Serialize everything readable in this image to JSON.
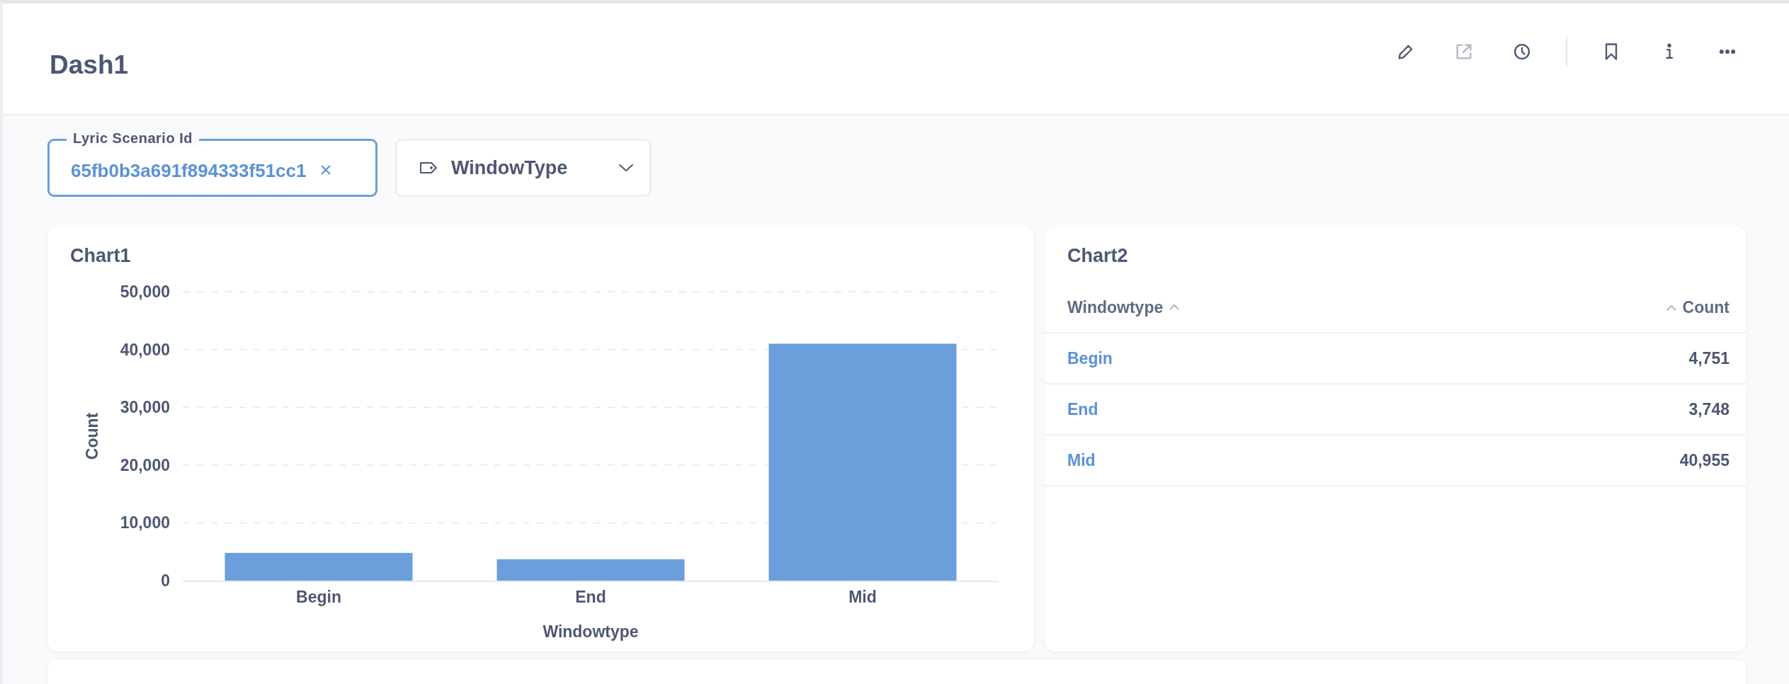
{
  "header": {
    "title": "Dash1",
    "actions": [
      {
        "kind": "edit",
        "disabled": false
      },
      {
        "kind": "share",
        "disabled": true
      },
      {
        "kind": "history",
        "disabled": false
      },
      {
        "kind": "separator"
      },
      {
        "kind": "bookmark",
        "disabled": false
      },
      {
        "kind": "info",
        "disabled": false
      },
      {
        "kind": "more",
        "disabled": false
      }
    ]
  },
  "filters": [
    {
      "kind": "text",
      "label": "Lyric Scenario Id",
      "value": "65fb0b3a691f894333f51cc1"
    },
    {
      "kind": "select",
      "label": "WindowType"
    }
  ],
  "chart1": {
    "title": "Chart1",
    "chart_data": {
      "type": "bar",
      "xlabel": "Windowtype",
      "ylabel": "Count",
      "categories": [
        "Begin",
        "End",
        "Mid"
      ],
      "grid": true,
      "series": [
        {
          "color": "#6a9fdc",
          "values": [
            4800,
            3700,
            41000
          ]
        }
      ],
      "ylim": [
        0,
        50000
      ],
      "yticks": [
        {
          "value": 0,
          "label": "0"
        },
        {
          "value": 10000,
          "label": "10,000"
        },
        {
          "value": 20000,
          "label": "20,000"
        },
        {
          "value": 30000,
          "label": "30,000"
        },
        {
          "value": 40000,
          "label": "40,000"
        },
        {
          "value": 50000,
          "label": "50,000"
        }
      ]
    }
  },
  "chart2": {
    "title": "Chart2",
    "columns": [
      {
        "label": "Windowtype"
      },
      {
        "label": "Count"
      }
    ],
    "rows": [
      [
        "Begin",
        "4,751"
      ],
      [
        "End",
        "3,748"
      ],
      [
        "Mid",
        "40,955"
      ]
    ]
  }
}
